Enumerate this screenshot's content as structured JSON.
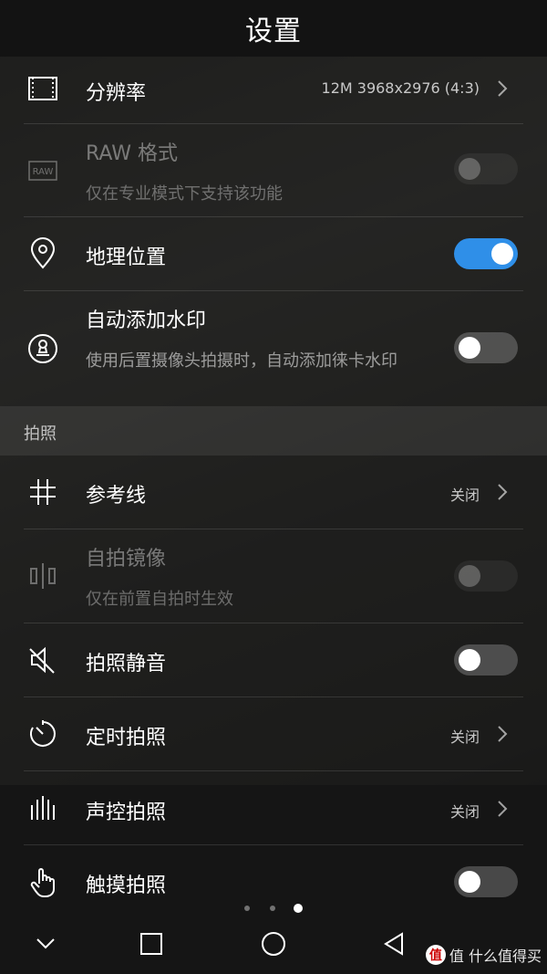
{
  "header": {
    "title": "设置"
  },
  "rows": {
    "resolution": {
      "label": "分辨率",
      "value": "12M 3968x2976 (4:3)",
      "icon": "resolution-icon"
    },
    "raw": {
      "label": "RAW 格式",
      "sub": "仅在专业模式下支持该功能",
      "icon": "raw-icon",
      "toggle": "off-disabled"
    },
    "location": {
      "label": "地理位置",
      "icon": "location-pin-icon",
      "toggle": "on"
    },
    "watermark": {
      "label": "自动添加水印",
      "sub": "使用后置摄像头拍摄时，自动添加徕卡水印",
      "icon": "stamp-icon",
      "toggle": "off"
    }
  },
  "section": {
    "title": "拍照"
  },
  "photo": {
    "grid": {
      "label": "参考线",
      "value": "关闭",
      "icon": "grid-icon"
    },
    "mirror": {
      "label": "自拍镜像",
      "sub": "仅在前置自拍时生效",
      "icon": "mirror-icon",
      "toggle": "off-disabled"
    },
    "mute": {
      "label": "拍照静音",
      "icon": "mute-speaker-icon",
      "toggle": "off"
    },
    "timer": {
      "label": "定时拍照",
      "value": "关闭",
      "icon": "timer-icon"
    },
    "voice": {
      "label": "声控拍照",
      "value": "关闭",
      "icon": "voice-bars-icon"
    },
    "touch": {
      "label": "触摸拍照",
      "icon": "touch-hand-icon",
      "toggle": "off"
    }
  },
  "pager": {
    "count": 3,
    "active": 3
  },
  "navbar": {
    "icons": [
      "chevron-down-icon",
      "square-recents-icon",
      "circle-home-icon",
      "triangle-back-icon"
    ]
  },
  "watermark_text": "值 什么值得买",
  "colors": {
    "accent": "#2f8fe8",
    "background": "#2a2a27"
  }
}
